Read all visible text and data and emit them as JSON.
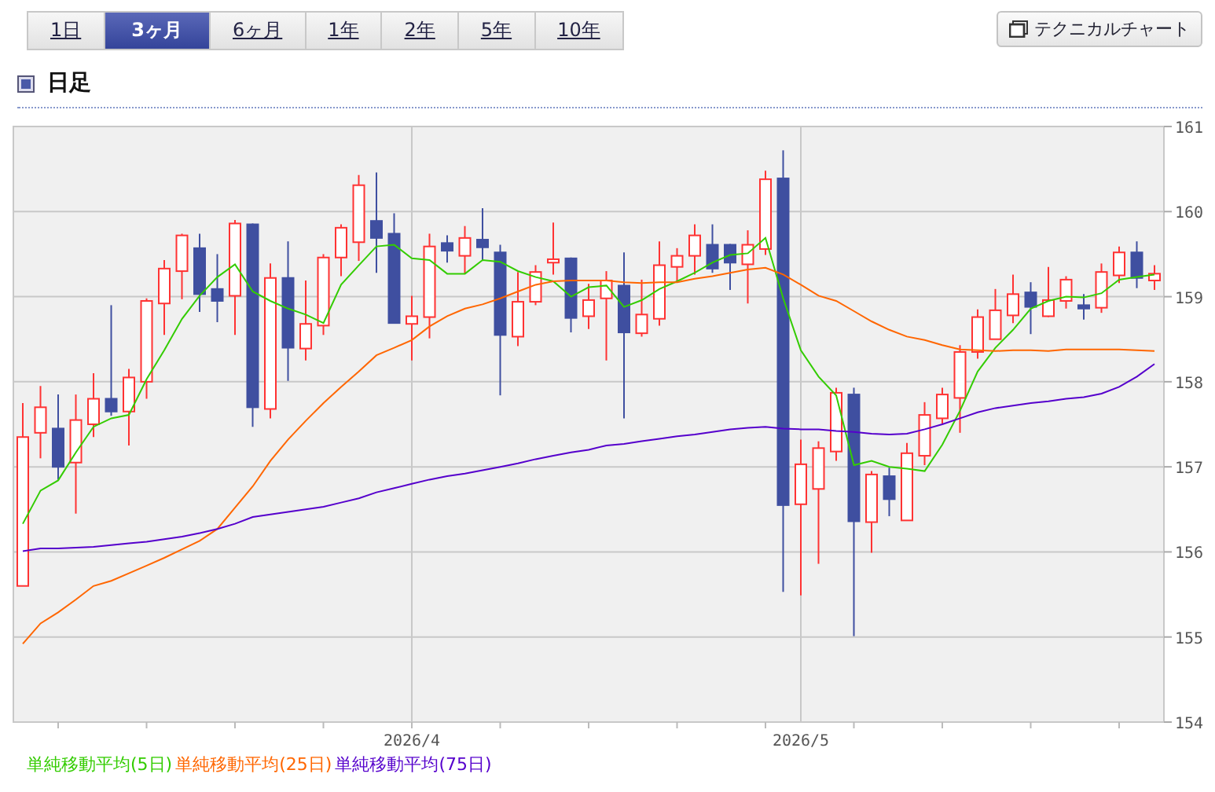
{
  "period_tabs": [
    {
      "label": "1日",
      "selected": false
    },
    {
      "label": "3ヶ月",
      "selected": true
    },
    {
      "label": "6ヶ月",
      "selected": false
    },
    {
      "label": "1年",
      "selected": false
    },
    {
      "label": "2年",
      "selected": false
    },
    {
      "label": "5年",
      "selected": false
    },
    {
      "label": "10年",
      "selected": false
    }
  ],
  "technical_button": {
    "label": "テクニカルチャート"
  },
  "section_title": "日足",
  "chart": {
    "chart_data": {
      "type": "candlestick",
      "grid": true,
      "ylim": [
        154,
        161
      ],
      "yticks": [
        154,
        155,
        156,
        157,
        158,
        159,
        160,
        161
      ],
      "categories": [
        null,
        null,
        null,
        null,
        null,
        null,
        null,
        null,
        null,
        null,
        null,
        null,
        null,
        null,
        null,
        null,
        null,
        null,
        null,
        null,
        null,
        null,
        "2026/4",
        null,
        null,
        null,
        null,
        null,
        null,
        null,
        null,
        null,
        null,
        null,
        null,
        null,
        null,
        null,
        null,
        null,
        null,
        null,
        null,
        null,
        "2026/5",
        null,
        null,
        null,
        null,
        null,
        null,
        null,
        null,
        null,
        null,
        null,
        null,
        null,
        null,
        null,
        null,
        null,
        null,
        null,
        null
      ],
      "ohlc": [
        [
          155.6,
          157.75,
          155.6,
          157.35
        ],
        [
          157.4,
          157.95,
          157.1,
          157.7
        ],
        [
          157.45,
          157.85,
          156.85,
          157.0
        ],
        [
          157.05,
          157.85,
          156.45,
          157.55
        ],
        [
          157.5,
          158.1,
          157.35,
          157.8
        ],
        [
          157.8,
          158.9,
          157.6,
          157.65
        ],
        [
          157.65,
          158.15,
          157.25,
          158.05
        ],
        [
          158.0,
          158.98,
          157.8,
          158.95
        ],
        [
          158.92,
          159.43,
          158.55,
          159.33
        ],
        [
          159.3,
          159.74,
          158.97,
          159.72
        ],
        [
          159.57,
          159.74,
          158.82,
          159.03
        ],
        [
          159.09,
          159.5,
          158.7,
          158.95
        ],
        [
          159.01,
          159.9,
          158.55,
          159.86
        ],
        [
          159.85,
          159.86,
          157.47,
          157.7
        ],
        [
          157.68,
          159.39,
          157.57,
          159.22
        ],
        [
          159.22,
          159.65,
          158.01,
          158.4
        ],
        [
          158.39,
          159.19,
          158.25,
          158.68
        ],
        [
          158.66,
          159.5,
          158.55,
          159.46
        ],
        [
          159.46,
          159.85,
          159.24,
          159.81
        ],
        [
          159.64,
          160.43,
          159.42,
          160.31
        ],
        [
          159.89,
          160.46,
          159.28,
          159.69
        ],
        [
          159.74,
          159.98,
          158.69,
          158.69
        ],
        [
          158.68,
          159.01,
          158.25,
          158.77
        ],
        [
          158.76,
          159.74,
          158.51,
          159.59
        ],
        [
          159.63,
          159.72,
          159.4,
          159.54
        ],
        [
          159.48,
          159.83,
          159.27,
          159.69
        ],
        [
          159.67,
          160.04,
          159.43,
          159.58
        ],
        [
          159.52,
          159.61,
          157.84,
          158.55
        ],
        [
          158.53,
          159.29,
          158.42,
          158.94
        ],
        [
          158.94,
          159.37,
          158.9,
          159.29
        ],
        [
          159.4,
          159.87,
          159.26,
          159.44
        ],
        [
          159.45,
          159.46,
          158.58,
          158.75
        ],
        [
          158.77,
          159.15,
          158.62,
          158.96
        ],
        [
          158.98,
          159.3,
          158.25,
          159.19
        ],
        [
          159.13,
          159.52,
          157.57,
          158.58
        ],
        [
          158.57,
          159.2,
          158.53,
          158.79
        ],
        [
          158.74,
          159.65,
          158.66,
          159.37
        ],
        [
          159.35,
          159.57,
          159.17,
          159.48
        ],
        [
          159.48,
          159.85,
          159.26,
          159.72
        ],
        [
          159.61,
          159.85,
          159.28,
          159.33
        ],
        [
          159.61,
          159.62,
          159.08,
          159.4
        ],
        [
          159.38,
          159.78,
          158.92,
          159.61
        ],
        [
          159.56,
          160.48,
          159.49,
          160.38
        ],
        [
          160.39,
          160.72,
          155.53,
          156.55
        ],
        [
          156.56,
          157.32,
          155.49,
          157.03
        ],
        [
          156.74,
          157.3,
          155.86,
          157.22
        ],
        [
          157.18,
          157.93,
          157.07,
          157.87
        ],
        [
          157.85,
          157.93,
          155.01,
          156.36
        ],
        [
          156.35,
          156.95,
          155.99,
          156.91
        ],
        [
          156.89,
          156.99,
          156.42,
          156.62
        ],
        [
          156.37,
          157.28,
          156.37,
          157.16
        ],
        [
          157.13,
          157.76,
          157.02,
          157.61
        ],
        [
          157.57,
          157.93,
          157.51,
          157.85
        ],
        [
          157.81,
          158.43,
          157.4,
          158.35
        ],
        [
          158.35,
          158.85,
          158.27,
          158.76
        ],
        [
          158.5,
          159.09,
          158.5,
          158.84
        ],
        [
          158.78,
          159.26,
          158.69,
          159.03
        ],
        [
          159.05,
          159.17,
          158.56,
          158.88
        ],
        [
          158.77,
          159.35,
          158.76,
          158.96
        ],
        [
          158.95,
          159.24,
          158.86,
          159.2
        ],
        [
          158.9,
          159.03,
          158.73,
          158.86
        ],
        [
          158.87,
          159.39,
          158.81,
          159.29
        ],
        [
          159.25,
          159.59,
          159.16,
          159.52
        ],
        [
          159.52,
          159.65,
          159.1,
          159.22
        ],
        [
          159.19,
          159.37,
          159.08,
          159.27
        ]
      ],
      "series": [
        {
          "name": "単純移動平均(5日)",
          "type": "line",
          "color": "#33cc00",
          "values": [
            156.33,
            156.72,
            156.84,
            157.17,
            157.47,
            157.57,
            157.61,
            158.03,
            158.37,
            158.74,
            159.01,
            159.23,
            159.38,
            159.06,
            158.95,
            158.86,
            158.79,
            158.69,
            159.14,
            159.37,
            159.59,
            159.61,
            159.45,
            159.43,
            159.27,
            159.27,
            159.43,
            159.41,
            159.3,
            159.23,
            159.18,
            159.0,
            159.11,
            159.13,
            158.88,
            158.96,
            159.09,
            159.18,
            159.28,
            159.4,
            159.49,
            159.51,
            159.69,
            158.98,
            158.37,
            158.06,
            157.84,
            157.02,
            157.07,
            157.0,
            156.98,
            156.95,
            157.26,
            157.66,
            158.12,
            158.4,
            158.61,
            158.86,
            158.95,
            159.0,
            158.99,
            159.04,
            159.2,
            159.23,
            159.26
          ]
        },
        {
          "name": "単純移動平均(25日)",
          "type": "line",
          "color": "#ff6600",
          "values": [
            154.92,
            155.16,
            155.29,
            155.44,
            155.6,
            155.66,
            155.75,
            155.84,
            155.93,
            156.03,
            156.13,
            156.27,
            156.52,
            156.77,
            157.07,
            157.32,
            157.54,
            157.75,
            157.94,
            158.12,
            158.31,
            158.4,
            158.49,
            158.65,
            158.77,
            158.86,
            158.91,
            158.98,
            159.06,
            159.14,
            159.18,
            159.19,
            159.19,
            159.19,
            159.17,
            159.16,
            159.17,
            159.17,
            159.21,
            159.24,
            159.28,
            159.32,
            159.34,
            159.26,
            159.14,
            159.01,
            158.95,
            158.83,
            158.71,
            158.61,
            158.53,
            158.49,
            158.43,
            158.38,
            158.37,
            158.36,
            158.37,
            158.37,
            158.36,
            158.38,
            158.38,
            158.38,
            158.38,
            158.37,
            158.36
          ]
        },
        {
          "name": "単純移動平均(75日)",
          "type": "line",
          "color": "#5500cc",
          "values": [
            156.01,
            156.04,
            156.04,
            156.05,
            156.06,
            156.08,
            156.1,
            156.12,
            156.15,
            156.18,
            156.22,
            156.27,
            156.33,
            156.41,
            156.44,
            156.47,
            156.5,
            156.53,
            156.58,
            156.63,
            156.7,
            156.75,
            156.8,
            156.85,
            156.89,
            156.92,
            156.96,
            157.0,
            157.04,
            157.09,
            157.13,
            157.17,
            157.2,
            157.25,
            157.27,
            157.3,
            157.33,
            157.36,
            157.38,
            157.41,
            157.44,
            157.46,
            157.47,
            157.45,
            157.44,
            157.44,
            157.42,
            157.41,
            157.39,
            157.38,
            157.39,
            157.44,
            157.5,
            157.57,
            157.64,
            157.69,
            157.72,
            157.75,
            157.77,
            157.8,
            157.82,
            157.86,
            157.94,
            158.06,
            158.21
          ]
        }
      ]
    }
  }
}
